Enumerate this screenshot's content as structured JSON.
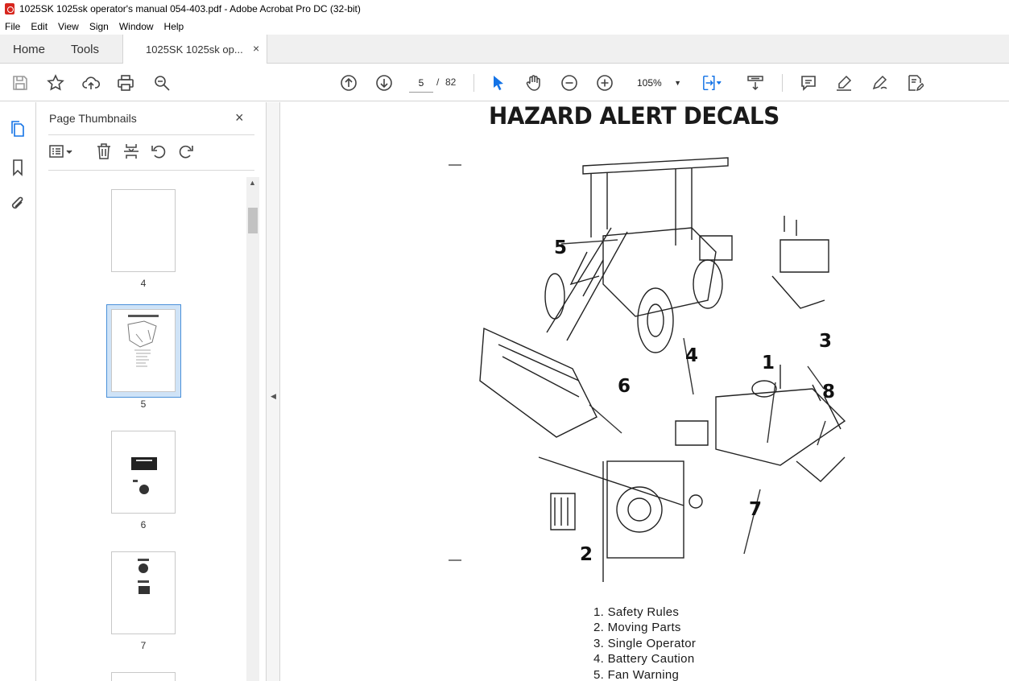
{
  "window": {
    "title": "1025SK 1025sk operator's manual 054-403.pdf - Adobe Acrobat Pro DC (32-bit)"
  },
  "menu": {
    "items": [
      "File",
      "Edit",
      "View",
      "Sign",
      "Window",
      "Help"
    ]
  },
  "tabs": {
    "home": "Home",
    "tools": "Tools",
    "document": "1025SK 1025sk op...",
    "close_glyph": "×"
  },
  "toolbar": {
    "current_page": "5",
    "separator": "/",
    "total_pages": "82",
    "zoom": "105%"
  },
  "thumbnails": {
    "title": "Page Thumbnails",
    "close_glyph": "×",
    "pages": [
      {
        "label": "4"
      },
      {
        "label": "5",
        "selected": true
      },
      {
        "label": "6"
      },
      {
        "label": "7"
      }
    ]
  },
  "document": {
    "heading": "HAZARD ALERT DECALS",
    "callouts": [
      "1",
      "2",
      "3",
      "4",
      "5",
      "6",
      "7",
      "8"
    ],
    "legend": [
      "1. Safety Rules",
      "2. Moving Parts",
      "3. Single Operator",
      "4. Battery Caution",
      "5. Fan Warning"
    ]
  },
  "colors": {
    "accent": "#1473e6",
    "selection": "#cfe3f7",
    "selection_border": "#4a90d9",
    "app_red": "#d7261e"
  }
}
